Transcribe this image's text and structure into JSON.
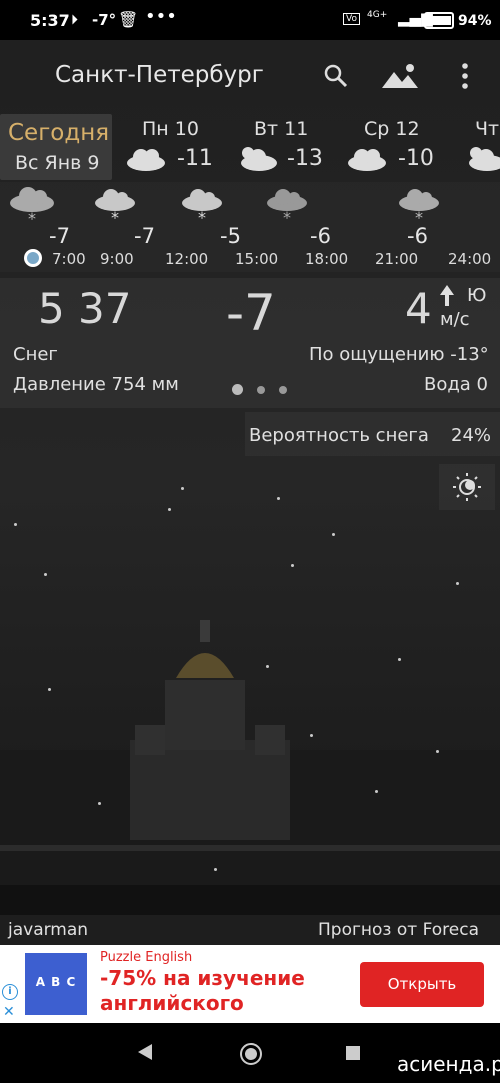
{
  "status": {
    "time": "5:37",
    "temp": "-7°",
    "network": "4G+",
    "battery": "94%"
  },
  "header": {
    "city": "Санкт-Петербург"
  },
  "days": {
    "today_label": "Сегодня",
    "today_date": "Вс Янв 9",
    "items": [
      {
        "name": "Пн 10",
        "temp": "-11"
      },
      {
        "name": "Вт 11",
        "temp": "-13"
      },
      {
        "name": "Ср 12",
        "temp": "-10"
      },
      {
        "name": "Чт",
        "temp": ""
      }
    ]
  },
  "hourly": [
    {
      "temp": "-7",
      "time": "7:00"
    },
    {
      "temp": "-7",
      "time": "9:00"
    },
    {
      "temp": "-5",
      "time": "12:00"
    },
    {
      "temp": "-6",
      "time": "15:00"
    },
    {
      "temp": "",
      "time": "18:00"
    },
    {
      "temp": "-6",
      "time": "21:00"
    },
    {
      "temp": "",
      "time": "24:00"
    }
  ],
  "current": {
    "time_h": "5",
    "time_m": "37",
    "temp": "-7",
    "wind_speed": "4",
    "wind_dir": "Ю",
    "wind_unit": "м/с",
    "condition": "Снег",
    "feels_like": "По ощущению -13°",
    "pressure": "Давление 754 мм",
    "water": "Вода 0",
    "snow_prob_label": "Вероятность снега",
    "snow_prob": "24%"
  },
  "footer": {
    "author": "javarman",
    "source": "Прогноз от Foreca"
  },
  "ad": {
    "brand": "Puzzle English",
    "headline": "-75% на изучение английского",
    "button": "Открыть",
    "badge_letters": "A B C"
  },
  "watermark": "асиенда.ру",
  "colors": {
    "today_accent": "#d7b06a",
    "ad_button": "#e02424",
    "ad_brand": "#e02424"
  }
}
